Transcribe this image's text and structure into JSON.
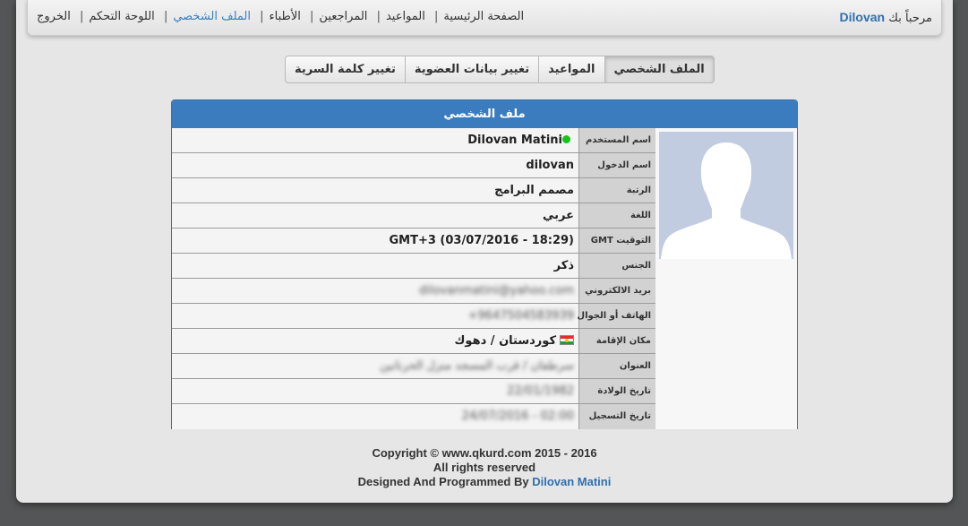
{
  "header": {
    "welcome_text": "مرحباً بك",
    "username": "Dilovan",
    "nav": [
      {
        "label": "الصفحة الرئيسية",
        "active": false
      },
      {
        "label": "المواعيد",
        "active": false
      },
      {
        "label": "المراجعين",
        "active": false
      },
      {
        "label": "الأطباء",
        "active": false
      },
      {
        "label": "الملف الشخصي",
        "active": true
      },
      {
        "label": "اللوحة التحكم",
        "active": false
      },
      {
        "label": "الخروج",
        "active": false
      }
    ],
    "separator": "|"
  },
  "tabs": [
    {
      "label": "الملف الشخصي",
      "active": true
    },
    {
      "label": "المواعيد",
      "active": false
    },
    {
      "label": "تغيير بيانات العضوية",
      "active": false
    },
    {
      "label": "تغيير كلمة السرية",
      "active": false
    }
  ],
  "profile": {
    "title": "ملف الشخصي",
    "avatar_icon": "user-silhouette-icon",
    "online_status_color": "#19c21a",
    "rows": [
      {
        "label": "اسم المستخدم",
        "value": "Dilovan Matini"
      },
      {
        "label": "اسم الدخول",
        "value": "dilovan"
      },
      {
        "label": "الرتبة",
        "value": "مصمم البرامج"
      },
      {
        "label": "اللغة",
        "value": "عربي"
      },
      {
        "label": "التوقيت GMT",
        "value": "GMT+3 (03/07/2016 - 18:29)"
      },
      {
        "label": "الجنس",
        "value": "ذكر"
      },
      {
        "label": "بريد الالكتروني",
        "value": "dilovanmatini@yahoo.com"
      },
      {
        "label": "الهاتف أو الجوال",
        "value": "+9647504583939"
      },
      {
        "label": "مكان الإقامة",
        "value": "كوردستان / دهوك"
      },
      {
        "label": "العنوان",
        "value": "سرطفان / قرب المسجد منزل الحرنانين"
      },
      {
        "label": "تاريخ الولادة",
        "value": "22/01/1982"
      },
      {
        "label": "تاريخ التسجيل",
        "value": "24/07/2016 - 02:00"
      }
    ]
  },
  "footer": {
    "line1": "Copyright © www.qkurd.com 2015 - 2016",
    "line2": "All rights reserved",
    "line3_prefix": "Designed And Programmed By",
    "line3_name": "Dilovan Matini"
  },
  "colors": {
    "accent": "#3b7cbf",
    "link": "#2f6fb0",
    "background": "#545556",
    "card": "#e6e6e6"
  }
}
